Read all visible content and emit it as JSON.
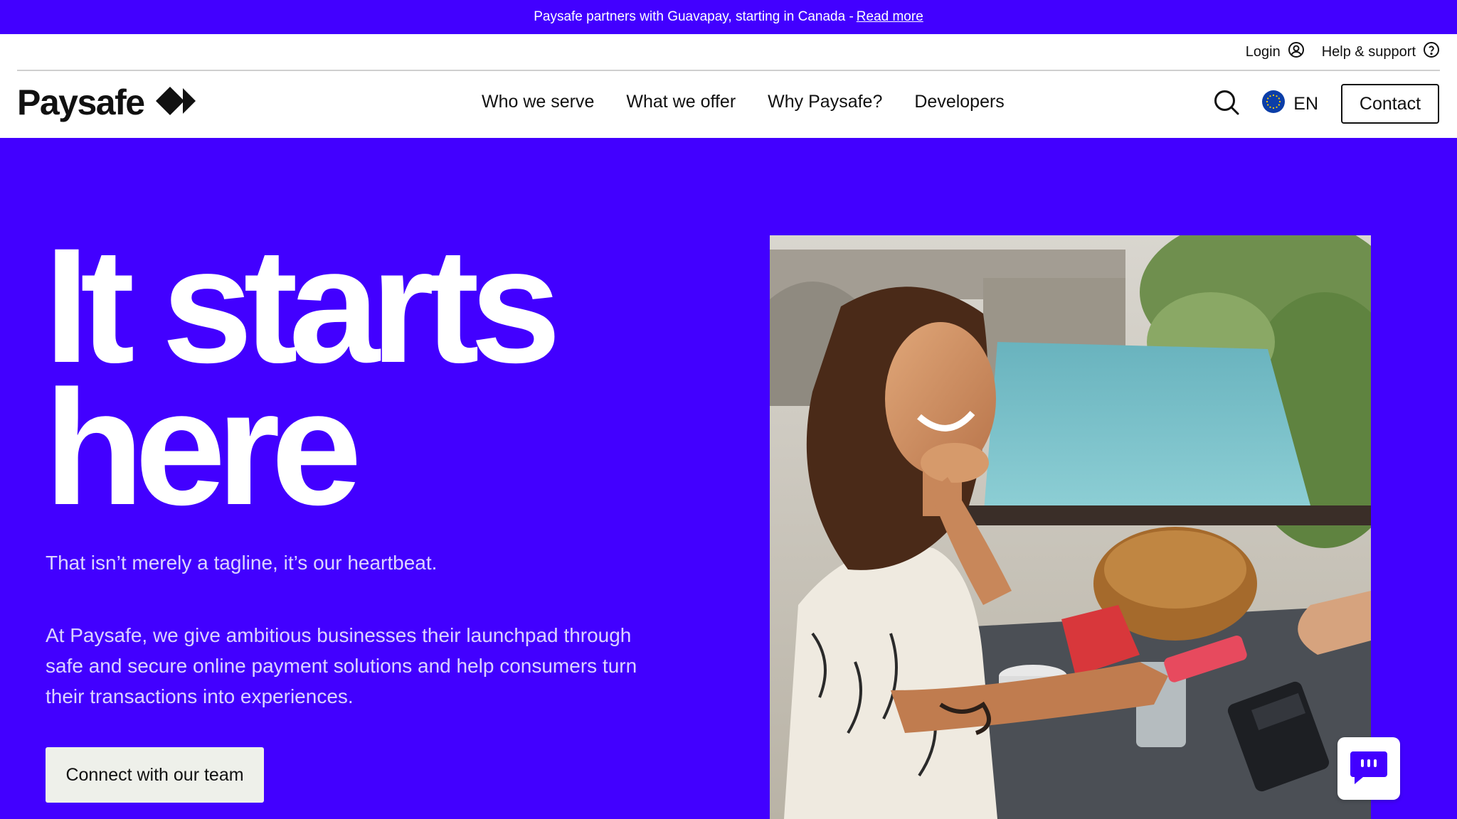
{
  "announcement": {
    "text": "Paysafe partners with Guavapay, starting in Canada - ",
    "link": "Read more"
  },
  "utility_nav": {
    "login": "Login",
    "help": "Help & support"
  },
  "logo": {
    "text": "Paysafe"
  },
  "main_nav": {
    "items": [
      "Who we serve",
      "What we offer",
      "Why Paysafe?",
      "Developers"
    ]
  },
  "language": {
    "label": "EN"
  },
  "contact": {
    "label": "Contact"
  },
  "hero": {
    "title_line1": "It starts",
    "title_line2": "here",
    "tagline": "That isn’t merely a tagline, it’s our heartbeat.",
    "description": "At Paysafe, we give ambitious businesses their launchpad through safe and secure online payment solutions and help consumers turn their transactions into experiences.",
    "cta": "Connect with our team"
  },
  "colors": {
    "brand_purple": "#4200FF",
    "text_dark": "#111111",
    "cta_bg": "#EEF0EA"
  },
  "icons": {
    "login": "user-circle-icon",
    "help": "question-circle-icon",
    "search": "search-icon",
    "language": "eu-flag-icon",
    "chat": "chat-icon"
  }
}
